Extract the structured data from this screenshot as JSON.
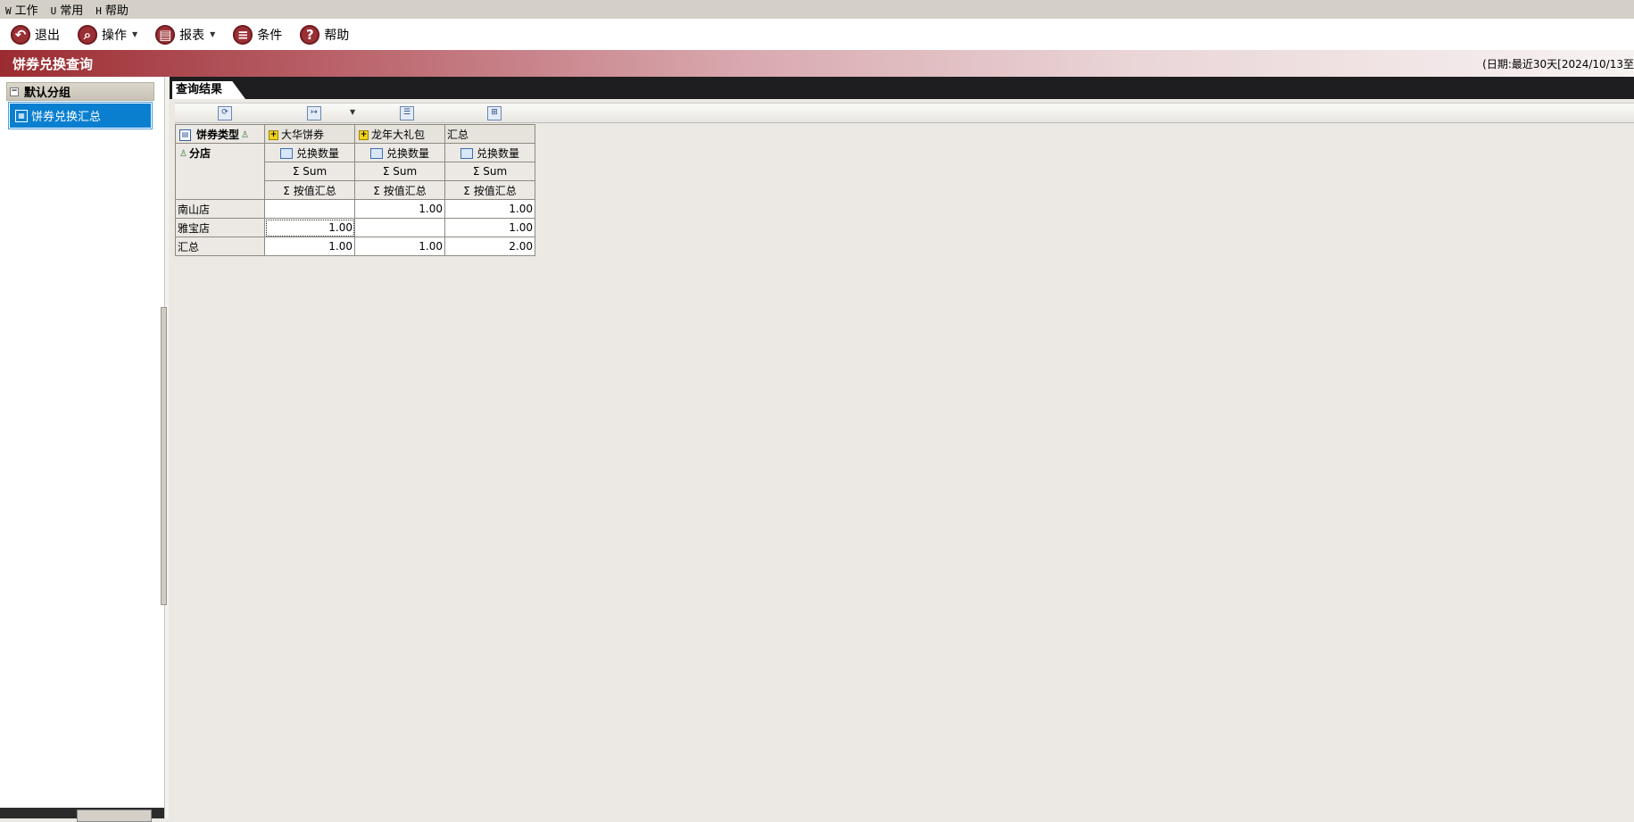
{
  "menubar": {
    "items": [
      {
        "key": "W",
        "label": "工作"
      },
      {
        "key": "U",
        "label": "常用"
      },
      {
        "key": "H",
        "label": "帮助"
      }
    ]
  },
  "toolbar": {
    "exit_label": "退出",
    "operate_label": "操作",
    "report_label": "报表",
    "condition_label": "条件",
    "help_label": "帮助"
  },
  "banner": {
    "title": "饼券兑换查询",
    "date_range": "(日期:最近30天[2024/10/13至"
  },
  "sidebar": {
    "group_label": "默认分组",
    "item_label": "饼券兑换汇总"
  },
  "tabs": {
    "result_label": "查询结果"
  },
  "pivot": {
    "column_field": "饼券类型",
    "row_field": "分店",
    "columns": [
      "大华饼券",
      "龙年大礼包",
      "汇总"
    ],
    "measure_label": "兑换数量",
    "aggregate_label": "Sum",
    "aggregate_symbol": "Σ",
    "value_label": "按值汇总",
    "rows": [
      {
        "label": "南山店",
        "values": [
          "",
          "1.00",
          "1.00"
        ]
      },
      {
        "label": "雅宝店",
        "values": [
          "1.00",
          "",
          "1.00"
        ]
      },
      {
        "label": "汇总",
        "values": [
          "1.00",
          "1.00",
          "2.00"
        ]
      }
    ]
  }
}
